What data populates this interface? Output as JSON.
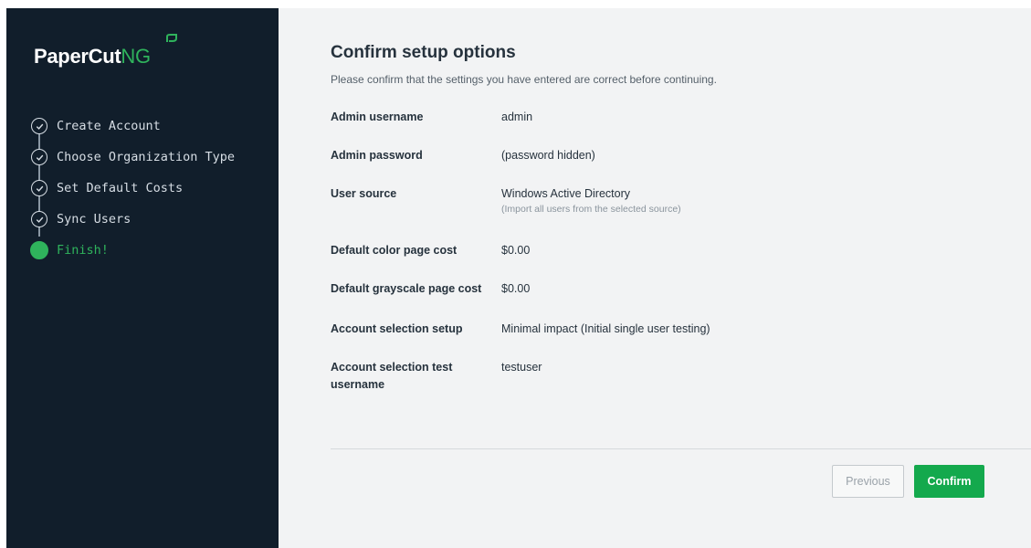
{
  "brand": {
    "name_main": "PaperCut",
    "name_suffix": "NG",
    "accent_color": "#2fb35c",
    "sidebar_bg": "#111e2b"
  },
  "steps": [
    {
      "label": "Create Account",
      "status": "done",
      "icon": "check-circle-icon"
    },
    {
      "label": "Choose Organization Type",
      "status": "done",
      "icon": "check-circle-icon"
    },
    {
      "label": "Set Default Costs",
      "status": "done",
      "icon": "check-circle-icon"
    },
    {
      "label": "Sync Users",
      "status": "done",
      "icon": "check-circle-icon"
    },
    {
      "label": "Finish!",
      "status": "active",
      "icon": "active-dot-icon"
    }
  ],
  "main": {
    "title": "Confirm setup options",
    "subtitle": "Please confirm that the settings you have entered are correct before continuing.",
    "fields": [
      {
        "label": "Admin username",
        "value": "admin"
      },
      {
        "label": "Admin password",
        "value": "(password hidden)"
      },
      {
        "label": "User source",
        "value": "Windows Active Directory",
        "hint": "(Import all users from the selected source)"
      },
      {
        "label": "Default color page cost",
        "value": "$0.00"
      },
      {
        "label": "Default grayscale page cost",
        "value": "$0.00"
      },
      {
        "label": "Account selection setup",
        "value": "Minimal impact (Initial single user testing)"
      },
      {
        "label": "Account selection test username",
        "value": "testuser"
      }
    ]
  },
  "buttons": {
    "previous": "Previous",
    "confirm": "Confirm",
    "confirm_color": "#14a94d"
  }
}
